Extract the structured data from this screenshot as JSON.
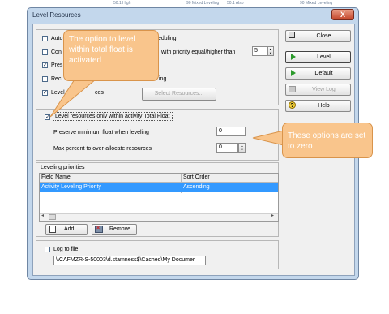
{
  "background_window": {
    "cells": [
      "50.1 High",
      "90 Mixed Leveling",
      "50.1 Also",
      "90 Mixed Leveling"
    ]
  },
  "window": {
    "title": "Level Resources",
    "close_glyph": "X"
  },
  "options": [
    {
      "label": "Auto",
      "label2": "eduling",
      "checked": false
    },
    {
      "label": "Con",
      "label2": "with priority equal/higher than",
      "checked": false,
      "value": "5"
    },
    {
      "label": "Pres",
      "checked": true
    },
    {
      "label": "Rec",
      "label2": "ing",
      "checked": false
    },
    {
      "label": "Level all",
      "label2": "ces",
      "checked": true
    }
  ],
  "select_resources_label": "Select Resources...",
  "total_float": {
    "label": "Level resources only within activity Total Float",
    "checked": true
  },
  "preserve_min_float": {
    "label": "Preserve minimum float when leveling",
    "value": "0"
  },
  "max_percent": {
    "label": "Max percent to over-allocate resources",
    "value": "0"
  },
  "leveling_priorities": {
    "title": "Leveling priorities",
    "columns": [
      "Field Name",
      "Sort Order"
    ],
    "rows": [
      {
        "field": "Activity Leveling Priority",
        "order": "Ascending"
      }
    ],
    "add_label": "Add",
    "remove_label": "Remove"
  },
  "log": {
    "label": "Log to file",
    "checked": false,
    "path": "\\\\CAFMZR-S-50003\\d.stamness$\\Cached\\My Documer"
  },
  "side_buttons": {
    "close": "Close",
    "level": "Level",
    "default": "Default",
    "view_log": "View Log",
    "help": "Help"
  },
  "callouts": {
    "top": "The option to level within total float is activated",
    "right": "These options are set to zero"
  },
  "colors": {
    "callout": "#f9c58c",
    "selected_row": "#3399ff",
    "frame": "#c3d7ec"
  }
}
